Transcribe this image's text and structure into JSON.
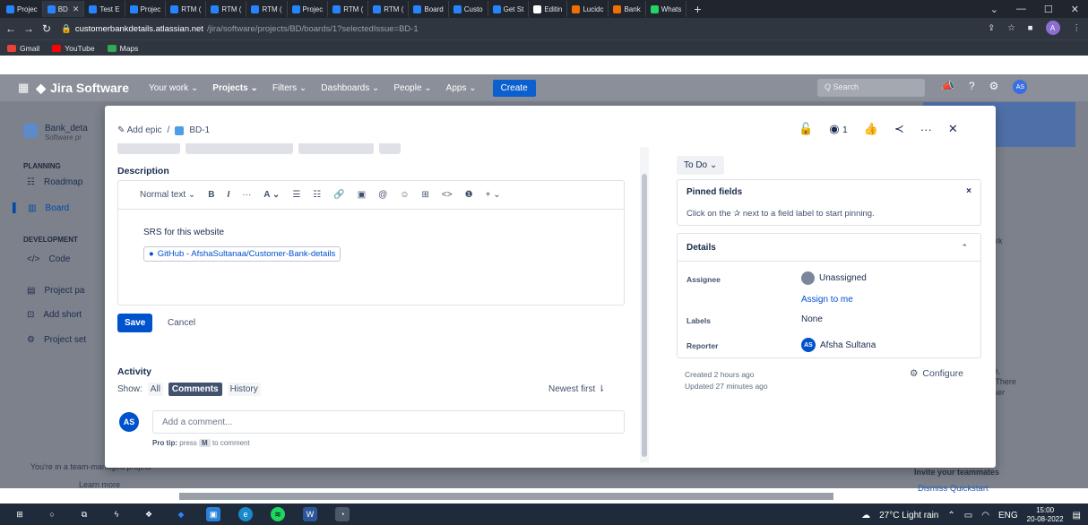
{
  "browser": {
    "tabs": [
      {
        "label": "Projec",
        "color": "#2684ff",
        "active": false
      },
      {
        "label": "BD",
        "color": "#2684ff",
        "active": true
      },
      {
        "label": "Test E",
        "color": "#2684ff",
        "active": false
      },
      {
        "label": "Projec",
        "color": "#2684ff",
        "active": false
      },
      {
        "label": "RTM (",
        "color": "#2684ff",
        "active": false
      },
      {
        "label": "RTM (",
        "color": "#2684ff",
        "active": false
      },
      {
        "label": "RTM (",
        "color": "#2684ff",
        "active": false
      },
      {
        "label": "Projec",
        "color": "#2684ff",
        "active": false
      },
      {
        "label": "RTM (",
        "color": "#2684ff",
        "active": false
      },
      {
        "label": "RTM (",
        "color": "#2684ff",
        "active": false
      },
      {
        "label": "Board",
        "color": "#2684ff",
        "active": false
      },
      {
        "label": "Custo",
        "color": "#2684ff",
        "active": false
      },
      {
        "label": "Get St",
        "color": "#2684ff",
        "active": false
      },
      {
        "label": "Editin",
        "color": "#ffffff",
        "active": false
      },
      {
        "label": "Lucidc",
        "color": "#f06f00",
        "active": false
      },
      {
        "label": "Bank",
        "color": "#f06f00",
        "active": false
      },
      {
        "label": "Whats",
        "color": "#25d366",
        "active": false
      }
    ],
    "new_tab": "+",
    "url_domain": "customerbankdetails.atlassian.net",
    "url_path": "/jira/software/projects/BD/boards/1?selectedIssue=BD-1",
    "profile_initial": "A",
    "bookmarks": [
      {
        "label": "Gmail",
        "color": "#ea4335"
      },
      {
        "label": "YouTube",
        "color": "#ff0000"
      },
      {
        "label": "Maps",
        "color": "#34a853"
      }
    ]
  },
  "jira": {
    "product": "Jira Software",
    "menu": [
      "Your work ⌄",
      "Projects ⌄",
      "Filters ⌄",
      "Dashboards ⌄",
      "People ⌄",
      "Apps ⌄"
    ],
    "create": "Create",
    "search_placeholder": "Q  Search",
    "avatar": "AS",
    "sidebar": {
      "project_name": "Bank_deta",
      "project_type": "Software pr",
      "planning": "PLANNING",
      "roadmap": "Roadmap",
      "board": "Board",
      "development": "DEVELOPMENT",
      "code": "Code",
      "project_pages": "Project pa",
      "add_shortcut": "Add short",
      "project_settings": "Project set",
      "footer": "You're in a team-managed project",
      "learn_more": "Learn more"
    },
    "right_panel": {
      "work": "ork",
      "desc_lines": [
        "ork",
        "vare,",
        "es. There",
        "e user"
      ],
      "invite": "Invite your teammates",
      "dismiss": "Dismiss Quickstart"
    }
  },
  "issue": {
    "add_epic": "Add epic",
    "separator": "/",
    "key": "BD-1",
    "watch_count": "1",
    "description_label": "Description",
    "toolbar": {
      "text_style": "Normal text ⌄",
      "bold": "B",
      "italic": "I",
      "more": "···",
      "color": "A ⌄",
      "bullets": "☰",
      "numbers": "☷",
      "link": "🔗",
      "image": "▣",
      "mention": "@",
      "emoji": "☺",
      "table": "⊞",
      "code": "<>",
      "info": "❶",
      "insert": "+ ⌄"
    },
    "description_text": "SRS for this website",
    "description_link": "GitHub - AfshaSultanaa/Customer-Bank-details",
    "save": "Save",
    "cancel": "Cancel",
    "activity_label": "Activity",
    "show_label": "Show:",
    "show_all": "All",
    "show_comments": "Comments",
    "show_history": "History",
    "newest_first": "Newest first ⇂",
    "comment_avatar": "AS",
    "comment_placeholder": "Add a comment...",
    "pro_tip_bold": "Pro tip:",
    "pro_tip_text": "press",
    "pro_tip_key": "M",
    "pro_tip_rest": "to comment",
    "status": "To Do ⌄",
    "pinned_title": "Pinned fields",
    "pinned_close": "×",
    "pinned_text": "Click on the ✰ next to a field label to start pinning.",
    "details_title": "Details",
    "assignee_label": "Assignee",
    "assignee_value": "Unassigned",
    "assign_to_me": "Assign to me",
    "labels_label": "Labels",
    "labels_value": "None",
    "reporter_label": "Reporter",
    "reporter_initials": "AS",
    "reporter_value": "Afsha Sultana",
    "created": "Created 2 hours ago",
    "updated": "Updated 27 minutes ago",
    "configure": "Configure"
  },
  "taskbar": {
    "weather": "27°C  Light rain",
    "lang": "ENG",
    "time": "15:00",
    "date": "20-08-2022"
  }
}
